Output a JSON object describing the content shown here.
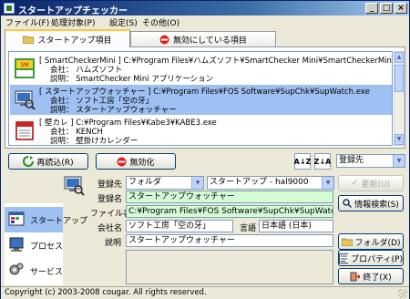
{
  "window": {
    "title": "スタートアップチェッカー"
  },
  "menu": [
    "ファイル(F)",
    "処理対象(P)",
    "設定(S)",
    "その他(O)"
  ],
  "tabs": [
    {
      "label": "スタートアップ項目",
      "icon": "folder-icon",
      "active": true
    },
    {
      "label": "無効にしている項目",
      "icon": "no-entry-icon",
      "active": false
    }
  ],
  "startup_list": [
    {
      "line1": "[ SmartCheckerMini ] C:¥Program Files¥ハムズソフト¥SmartChecker Mini¥SmartCheckerMini.exe",
      "line2": "会社： ハムズソフト",
      "line3": "説明： SmartChecker Mini アプリケーション",
      "icon": "smartchecker-icon",
      "selected": false
    },
    {
      "line1": "[ スタートアップウォッチャー ] C:¥Program Files¥FOS Software¥SupChk¥SupWatch.exe",
      "line2": "会社： ソフト工房「空の牙」",
      "line3": "説明： スタートアップウォッチャー",
      "icon": "supwatch-icon",
      "selected": true
    },
    {
      "line1": "[ 壁カレ ] C:¥Program Files¥Kabe3¥KABE3.exe",
      "line2": "会社： KENCH",
      "line3": "説明： 壁掛けカレンダー",
      "icon": "calendar-icon",
      "selected": false
    }
  ],
  "toolbar": {
    "reload_label": "再読込(R)",
    "disable_label": "無効化",
    "sort_asc_label": "A↓Z",
    "sort_desc_label": "Z↓A",
    "sort_key": "登録先"
  },
  "categories": [
    {
      "label": "スタートアップ",
      "icon": "startup-icon",
      "selected": true
    },
    {
      "label": "プロセス",
      "icon": "process-icon",
      "selected": false
    },
    {
      "label": "サービス",
      "icon": "service-icon",
      "selected": false
    }
  ],
  "details": {
    "location_label": "登録先",
    "location_type": "フォルダ",
    "location_value": "スタートアップ - hal9000",
    "name_label": "登録名",
    "name_value": "スタートアップウォッチャー",
    "file_label": "ファイル名",
    "file_value": "C:¥Program Files¥FOS Software¥SupChk¥SupWatch.exe",
    "company_label": "会社名",
    "company_value": "ソフト工房「空の牙」",
    "language_label": "言語",
    "language_value": "日本語 (日本)",
    "description_label": "説明",
    "description_value": "スタートアップウォッチャー"
  },
  "actions": {
    "update_label": "更新(U)",
    "info_search_label": "情報検索(S)",
    "folder_label": "フォルダ(D)",
    "properties_label": "プロパティ(P)",
    "exit_label": "終了(X)"
  },
  "status": {
    "text": "Copyright (c) 2003-2008 cougar. All rights reserved."
  },
  "colors": {
    "selection": "#9ec0f2",
    "green_field": "#d4fcd4",
    "title_bar": "#0a246a"
  }
}
